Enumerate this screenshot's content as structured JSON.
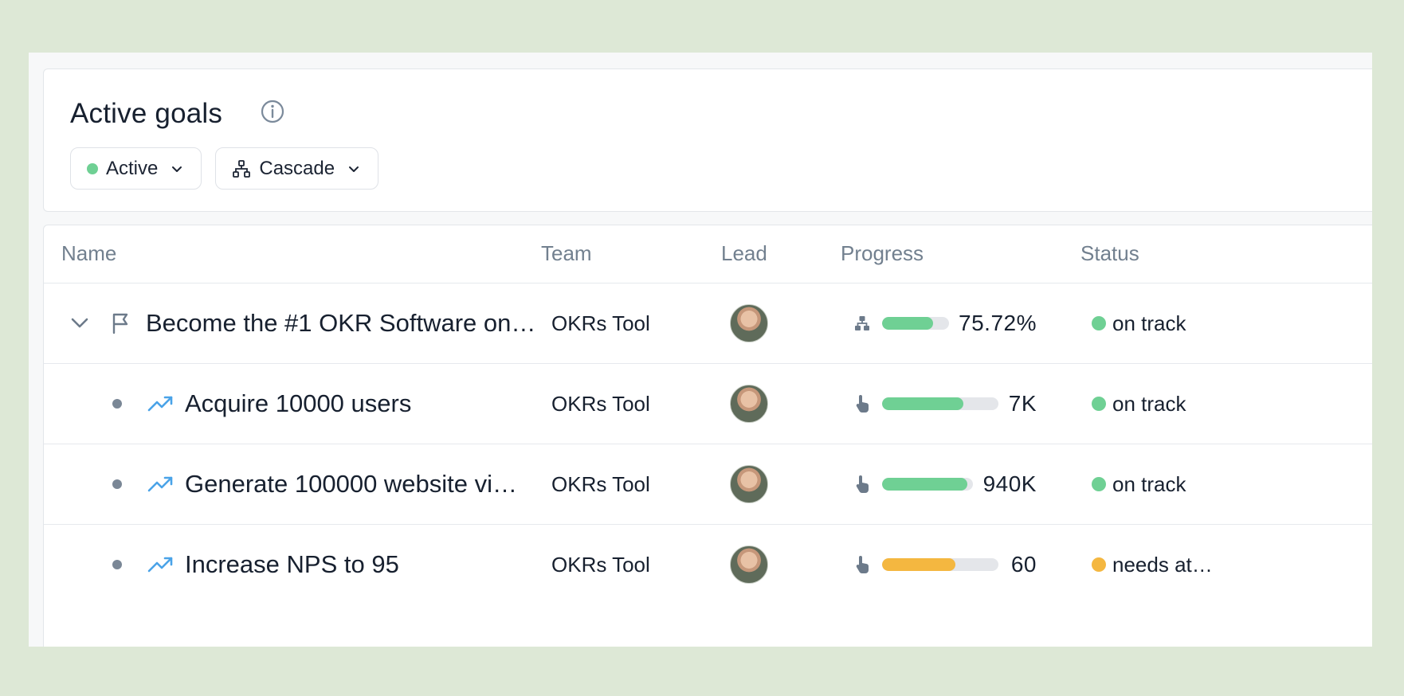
{
  "header": {
    "title": "Active goals",
    "info_icon": "info-circle-icon"
  },
  "filters": [
    {
      "label": "Active",
      "icon": "green-dot",
      "chevron": "chevron-down-icon"
    },
    {
      "label": "Cascade",
      "icon": "hierarchy-icon",
      "chevron": "chevron-down-icon"
    }
  ],
  "table": {
    "columns": [
      "Name",
      "Team",
      "Lead",
      "Progress",
      "Status"
    ],
    "rows": [
      {
        "name": "Become the #1 OKR Software on…",
        "row_icon": "flag-icon",
        "expand_icon": "chevron-down-icon",
        "team": "OKRs Tool",
        "progress_icon": "hierarchy-icon",
        "progress_fraction": 0.7572,
        "progress_text": "75.72%",
        "bar_color": "#6fd094",
        "status": "on track",
        "status_color": "#6fd094"
      },
      {
        "name": "Acquire 10000 users",
        "row_icon": "trending-up-icon",
        "team": "OKRs Tool",
        "progress_icon": "hand-pointer-icon",
        "progress_fraction": 0.7,
        "progress_text": "7K",
        "bar_color": "#6fd094",
        "status": "on track",
        "status_color": "#6fd094"
      },
      {
        "name": "Generate 100000 website vi…",
        "row_icon": "trending-up-icon",
        "team": "OKRs Tool",
        "progress_icon": "hand-pointer-icon",
        "progress_fraction": 0.94,
        "progress_text": "940K",
        "bar_color": "#6fd094",
        "status": "on track",
        "status_color": "#6fd094"
      },
      {
        "name": "Increase NPS to 95",
        "row_icon": "trending-up-icon",
        "team": "OKRs Tool",
        "progress_icon": "hand-pointer-icon",
        "progress_fraction": 0.63,
        "progress_text": "60",
        "bar_color": "#f4b740",
        "status": "needs at…",
        "status_color": "#f4b740"
      }
    ]
  },
  "colors": {
    "background": "#dde8d6",
    "accent_green": "#6fd094",
    "accent_yellow": "#f4b740",
    "trend_blue": "#4aa3e8"
  }
}
